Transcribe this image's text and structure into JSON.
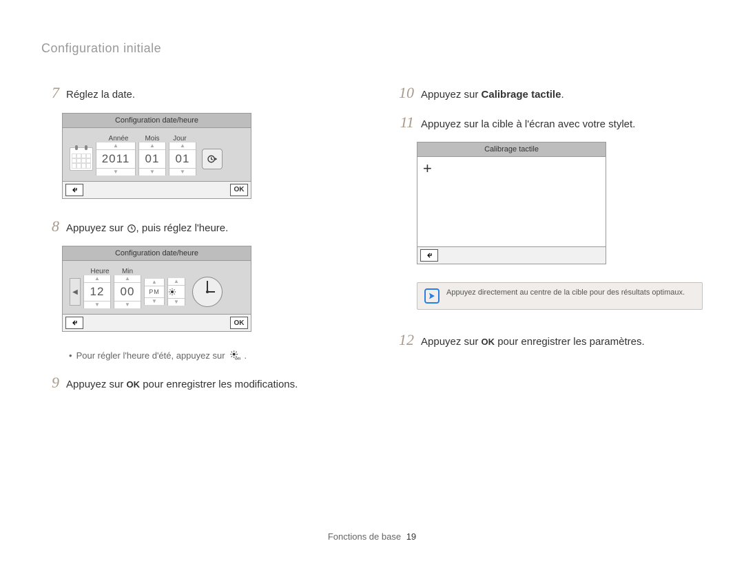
{
  "breadcrumb": "Configuration initiale",
  "steps": {
    "s7": {
      "num": "7",
      "text": "Réglez la date."
    },
    "s8": {
      "num": "8",
      "text_a": "Appuyez sur ",
      "text_b": ", puis réglez l'heure."
    },
    "s9": {
      "num": "9",
      "text_a": "Appuyez sur ",
      "text_b": " pour enregistrer les modifications."
    },
    "s10": {
      "num": "10",
      "text_a": "Appuyez sur ",
      "bold": "Calibrage tactile",
      "text_b": "."
    },
    "s11": {
      "num": "11",
      "text": "Appuyez sur la cible à l'écran avec votre stylet."
    },
    "s12": {
      "num": "12",
      "text_a": "Appuyez sur ",
      "text_b": " pour enregistrer les paramètres."
    }
  },
  "sub_note": "Pour régler l'heure d'été, appuyez sur ",
  "inline_ok": "OK",
  "date_screen": {
    "title": "Configuration date/heure",
    "labels": {
      "year": "Année",
      "month": "Mois",
      "day": "Jour"
    },
    "values": {
      "year": "2011",
      "month": "01",
      "day": "01"
    },
    "footer_ok": "OK"
  },
  "time_screen": {
    "title": "Configuration date/heure",
    "labels": {
      "hour": "Heure",
      "min": "Min"
    },
    "values": {
      "hour": "12",
      "min": "00",
      "ampm": "PM"
    },
    "footer_ok": "OK"
  },
  "calib_screen": {
    "title": "Calibrage tactile"
  },
  "note": "Appuyez directement au centre de la cible pour des résultats optimaux.",
  "footer": {
    "label": "Fonctions de base",
    "page": "19"
  }
}
